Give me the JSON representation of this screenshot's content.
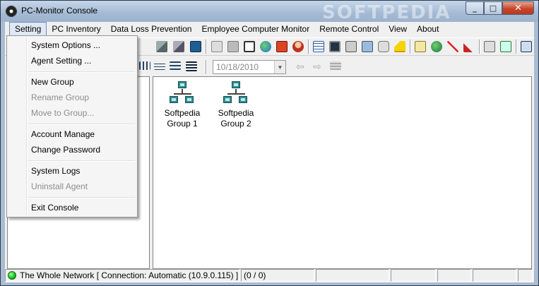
{
  "window": {
    "title": "PC-Monitor Console",
    "watermark": "SOFTPEDIA",
    "controls": {
      "minimize": "_",
      "maximize": "□",
      "close": "✕"
    }
  },
  "menubar": {
    "items": [
      "Setting",
      "PC Inventory",
      "Data Loss Prevention",
      "Employee Computer Monitor",
      "Remote Control",
      "View",
      "About"
    ]
  },
  "setting_menu": {
    "items": [
      {
        "label": "System Options ...",
        "enabled": true
      },
      {
        "label": "Agent Setting ...",
        "enabled": true
      },
      {
        "label": "New Group",
        "enabled": true
      },
      {
        "label": "Rename Group",
        "enabled": false
      },
      {
        "label": "Move to Group...",
        "enabled": false
      },
      {
        "label": "Account Manage",
        "enabled": true
      },
      {
        "label": "Change Password",
        "enabled": true
      },
      {
        "label": "System Logs",
        "enabled": true
      },
      {
        "label": "Uninstall Agent",
        "enabled": false
      },
      {
        "label": "Exit Console",
        "enabled": true
      }
    ]
  },
  "toolbar": {
    "date": "10/18/2010"
  },
  "groups": [
    {
      "name_line1": "Softpedia",
      "name_line2": "Group 1"
    },
    {
      "name_line1": "Softpedia",
      "name_line2": "Group 2"
    }
  ],
  "statusbar": {
    "network": "The Whole Network [ Connection: Automatic (10.9.0.115) ]",
    "count": "(0 / 0)"
  },
  "colors": {
    "status_dot": "#17c117",
    "titlebar": "#a4bad4",
    "close_button": "#c8452a"
  }
}
